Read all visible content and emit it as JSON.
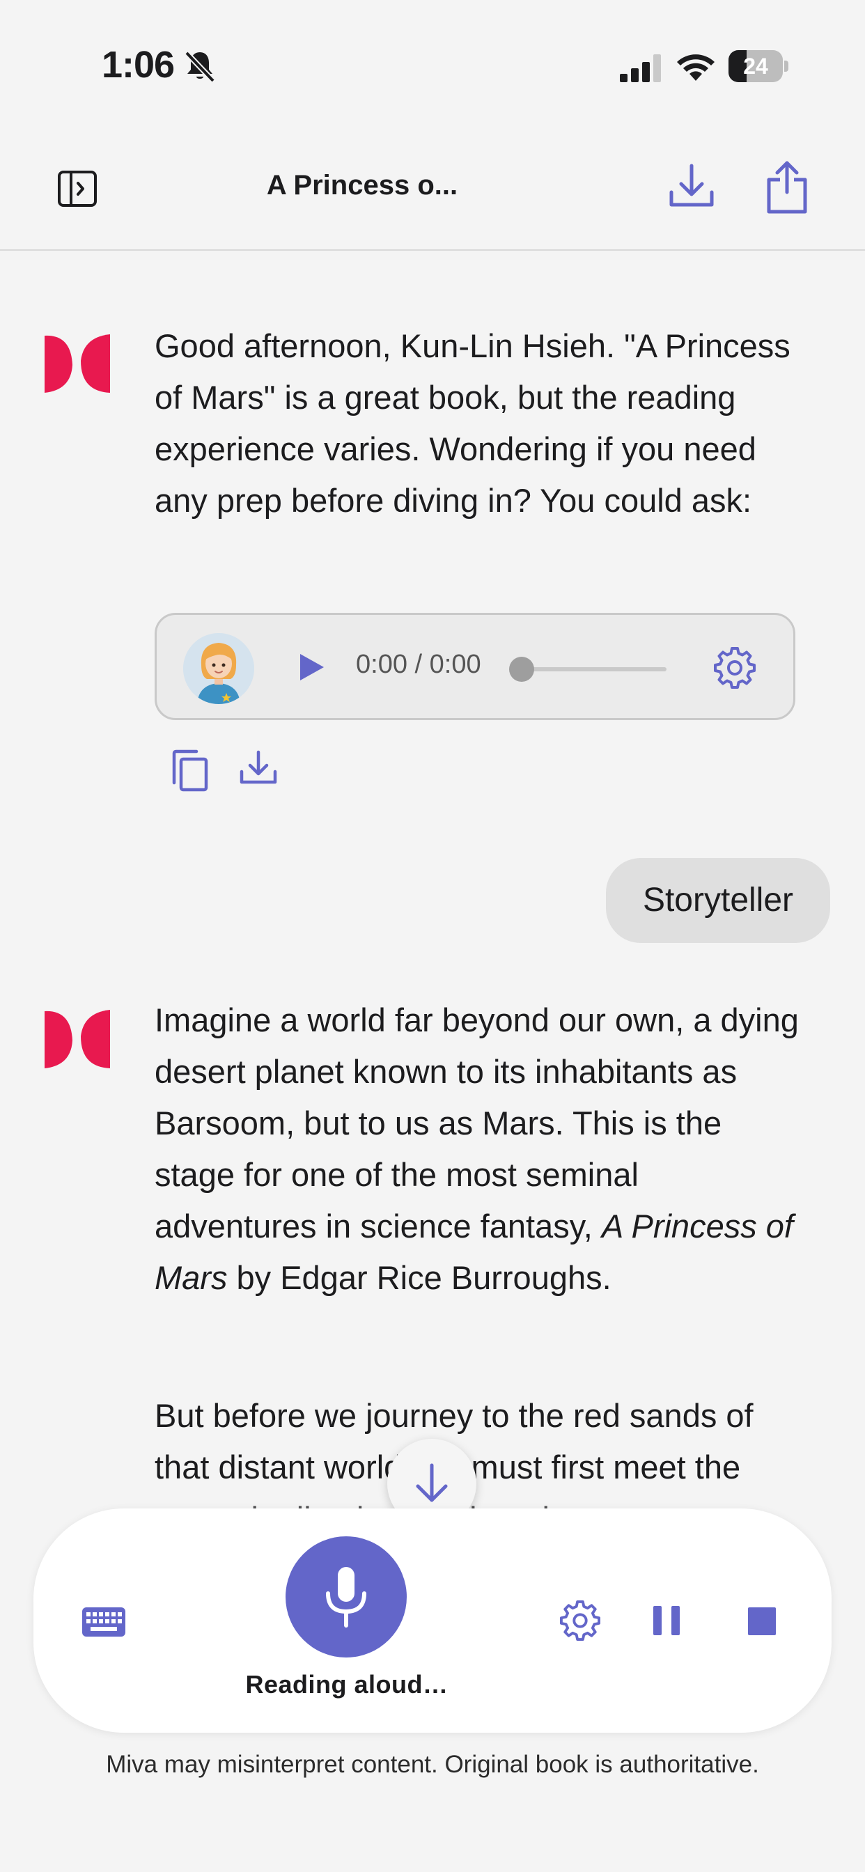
{
  "status_bar": {
    "time": "1:06",
    "battery": "24"
  },
  "nav": {
    "title": "A Princess o..."
  },
  "messages": [
    {
      "role": "assistant",
      "text": "Good afternoon, Kun-Lin Hsieh. \"A Princess of Mars\" is a great book, but the reading experience varies. Wondering if you need any prep before diving in? You could ask:"
    },
    {
      "role": "user",
      "text": "Storyteller"
    },
    {
      "role": "assistant",
      "p1_before": "Imagine a world far beyond our own, a dying desert planet known to its inhabitants as Barsoom, but to us as Mars. This is the stage for one of the most seminal adventures in science fantasy, ",
      "p1_italic": "A Princess of Mars",
      "p1_after": " by Edgar Rice Burroughs.",
      "p2": "But before we journey to the red sands of that distant world, we must first meet the man who lived to tell the tale"
    }
  ],
  "audio_player": {
    "time": "0:00 / 0:00",
    "progress": 0
  },
  "controls": {
    "status_label": "Reading aloud…"
  },
  "footer": {
    "disclaimer": "Miva may misinterpret content. Original book is authoritative."
  },
  "colors": {
    "accent": "#6366c9",
    "logo": "#e8194f",
    "background": "#f4f4f4"
  },
  "icons": [
    "bell-slash-icon",
    "cellular-signal-icon",
    "wifi-icon",
    "battery-icon",
    "sidebar-toggle-icon",
    "download-icon",
    "share-icon",
    "brand-logo-icon",
    "play-icon",
    "gear-icon",
    "copy-icon",
    "arrow-down-icon",
    "keyboard-icon",
    "microphone-icon",
    "pause-icon",
    "stop-icon"
  ]
}
